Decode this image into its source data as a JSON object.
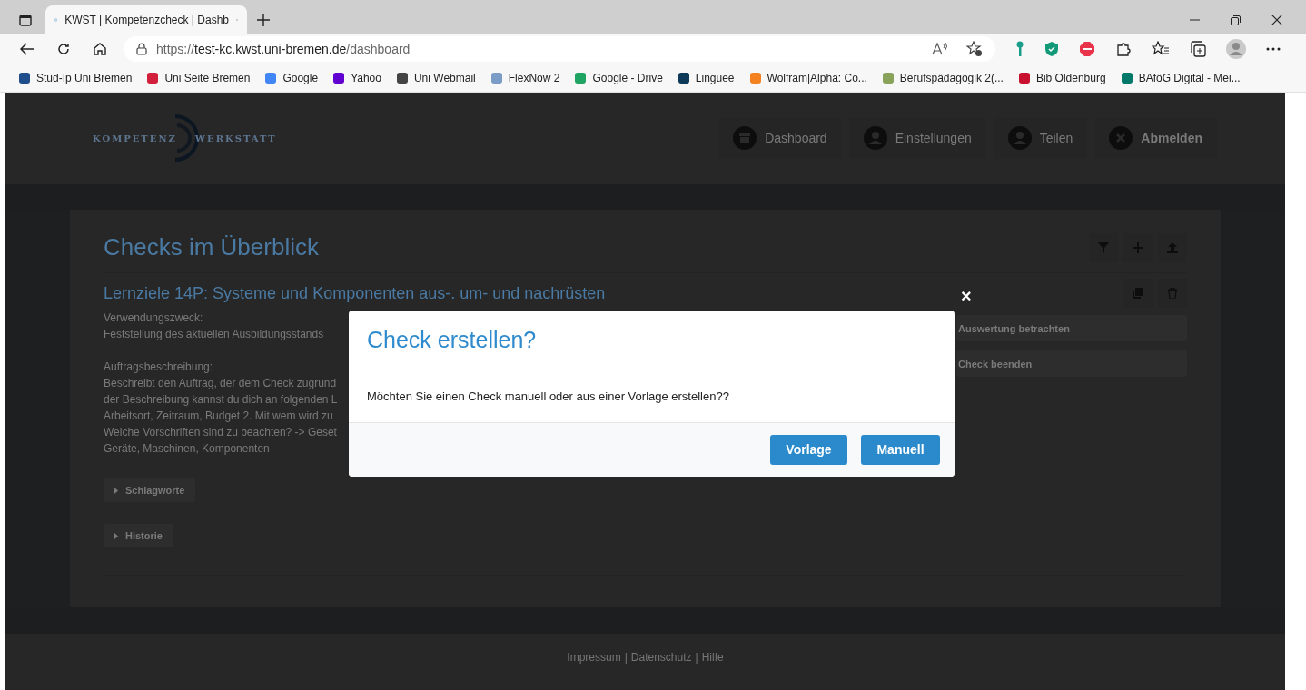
{
  "browser": {
    "tab_title": "KWST | Kompetenzcheck | Dashb",
    "url_scheme": "https://",
    "url_host": "test-kc.kwst.uni-bremen.de",
    "url_path": "/dashboard",
    "bookmarks": [
      "Stud-Ip Uni Bremen",
      "Uni Seite Bremen",
      "Google",
      "Yahoo",
      "Uni Webmail",
      "FlexNow 2",
      "Google - Drive",
      "Linguee",
      "Wolfram|Alpha: Co...",
      "Berufspädagogik 2(...",
      "Bib Oldenburg",
      "BAföG Digital - Mei..."
    ]
  },
  "header": {
    "logo_left": "KOMPETENZ",
    "logo_right": "WERKSTATT",
    "nav": [
      {
        "label": "Dashboard",
        "kind": "archive"
      },
      {
        "label": "Einstellungen",
        "kind": "user"
      },
      {
        "label": "Teilen",
        "kind": "user"
      },
      {
        "label": "Abmelden",
        "kind": "logout"
      }
    ]
  },
  "card": {
    "title": "Checks im Überblick",
    "check_title": "Lernziele 14P: Systeme und Komponenten aus-. um- und nachrüsten",
    "purpose_label": "Verwendungszweck:",
    "purpose": "Feststellung des aktuellen Ausbildungsstands",
    "task_label": "Auftragsbeschreibung:",
    "task_lines": [
      "Beschreibt den Auftrag, der dem Check zugrund",
      "der Beschreibung kannst du dich an folgenden L",
      "Arbeitsort, Zeitraum, Budget 2. Mit wem wird zu",
      "Welche Vorschriften sind zu beachten? -> Geset",
      "Geräte, Maschinen, Komponenten"
    ],
    "collapsibles": [
      "Schlagworte",
      "Historie"
    ],
    "actions": [
      "Auswertung betrachten",
      "Check beenden"
    ]
  },
  "footer": {
    "links": [
      "Impressum",
      "Datenschutz",
      "Hilfe"
    ],
    "separator": "|"
  },
  "modal": {
    "title": "Check erstellen?",
    "message": "Möchten Sie einen Check manuell oder aus einer Vorlage erstellen??",
    "buttons": [
      "Vorlage",
      "Manuell"
    ],
    "close": "×"
  }
}
